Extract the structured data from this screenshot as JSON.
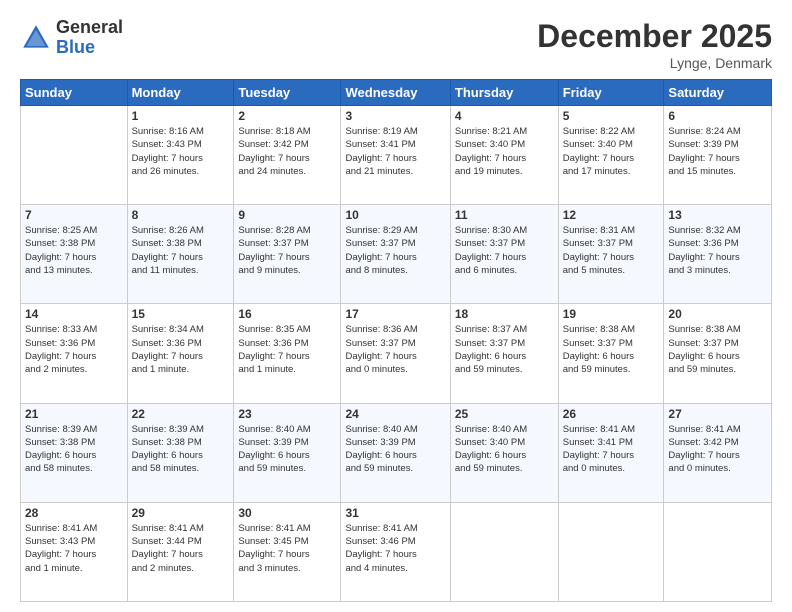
{
  "logo": {
    "general": "General",
    "blue": "Blue"
  },
  "title": "December 2025",
  "location": "Lynge, Denmark",
  "weekdays": [
    "Sunday",
    "Monday",
    "Tuesday",
    "Wednesday",
    "Thursday",
    "Friday",
    "Saturday"
  ],
  "weeks": [
    [
      {
        "num": "",
        "info": ""
      },
      {
        "num": "1",
        "info": "Sunrise: 8:16 AM\nSunset: 3:43 PM\nDaylight: 7 hours\nand 26 minutes."
      },
      {
        "num": "2",
        "info": "Sunrise: 8:18 AM\nSunset: 3:42 PM\nDaylight: 7 hours\nand 24 minutes."
      },
      {
        "num": "3",
        "info": "Sunrise: 8:19 AM\nSunset: 3:41 PM\nDaylight: 7 hours\nand 21 minutes."
      },
      {
        "num": "4",
        "info": "Sunrise: 8:21 AM\nSunset: 3:40 PM\nDaylight: 7 hours\nand 19 minutes."
      },
      {
        "num": "5",
        "info": "Sunrise: 8:22 AM\nSunset: 3:40 PM\nDaylight: 7 hours\nand 17 minutes."
      },
      {
        "num": "6",
        "info": "Sunrise: 8:24 AM\nSunset: 3:39 PM\nDaylight: 7 hours\nand 15 minutes."
      }
    ],
    [
      {
        "num": "7",
        "info": "Sunrise: 8:25 AM\nSunset: 3:38 PM\nDaylight: 7 hours\nand 13 minutes."
      },
      {
        "num": "8",
        "info": "Sunrise: 8:26 AM\nSunset: 3:38 PM\nDaylight: 7 hours\nand 11 minutes."
      },
      {
        "num": "9",
        "info": "Sunrise: 8:28 AM\nSunset: 3:37 PM\nDaylight: 7 hours\nand 9 minutes."
      },
      {
        "num": "10",
        "info": "Sunrise: 8:29 AM\nSunset: 3:37 PM\nDaylight: 7 hours\nand 8 minutes."
      },
      {
        "num": "11",
        "info": "Sunrise: 8:30 AM\nSunset: 3:37 PM\nDaylight: 7 hours\nand 6 minutes."
      },
      {
        "num": "12",
        "info": "Sunrise: 8:31 AM\nSunset: 3:37 PM\nDaylight: 7 hours\nand 5 minutes."
      },
      {
        "num": "13",
        "info": "Sunrise: 8:32 AM\nSunset: 3:36 PM\nDaylight: 7 hours\nand 3 minutes."
      }
    ],
    [
      {
        "num": "14",
        "info": "Sunrise: 8:33 AM\nSunset: 3:36 PM\nDaylight: 7 hours\nand 2 minutes."
      },
      {
        "num": "15",
        "info": "Sunrise: 8:34 AM\nSunset: 3:36 PM\nDaylight: 7 hours\nand 1 minute."
      },
      {
        "num": "16",
        "info": "Sunrise: 8:35 AM\nSunset: 3:36 PM\nDaylight: 7 hours\nand 1 minute."
      },
      {
        "num": "17",
        "info": "Sunrise: 8:36 AM\nSunset: 3:37 PM\nDaylight: 7 hours\nand 0 minutes."
      },
      {
        "num": "18",
        "info": "Sunrise: 8:37 AM\nSunset: 3:37 PM\nDaylight: 6 hours\nand 59 minutes."
      },
      {
        "num": "19",
        "info": "Sunrise: 8:38 AM\nSunset: 3:37 PM\nDaylight: 6 hours\nand 59 minutes."
      },
      {
        "num": "20",
        "info": "Sunrise: 8:38 AM\nSunset: 3:37 PM\nDaylight: 6 hours\nand 59 minutes."
      }
    ],
    [
      {
        "num": "21",
        "info": "Sunrise: 8:39 AM\nSunset: 3:38 PM\nDaylight: 6 hours\nand 58 minutes."
      },
      {
        "num": "22",
        "info": "Sunrise: 8:39 AM\nSunset: 3:38 PM\nDaylight: 6 hours\nand 58 minutes."
      },
      {
        "num": "23",
        "info": "Sunrise: 8:40 AM\nSunset: 3:39 PM\nDaylight: 6 hours\nand 59 minutes."
      },
      {
        "num": "24",
        "info": "Sunrise: 8:40 AM\nSunset: 3:39 PM\nDaylight: 6 hours\nand 59 minutes."
      },
      {
        "num": "25",
        "info": "Sunrise: 8:40 AM\nSunset: 3:40 PM\nDaylight: 6 hours\nand 59 minutes."
      },
      {
        "num": "26",
        "info": "Sunrise: 8:41 AM\nSunset: 3:41 PM\nDaylight: 7 hours\nand 0 minutes."
      },
      {
        "num": "27",
        "info": "Sunrise: 8:41 AM\nSunset: 3:42 PM\nDaylight: 7 hours\nand 0 minutes."
      }
    ],
    [
      {
        "num": "28",
        "info": "Sunrise: 8:41 AM\nSunset: 3:43 PM\nDaylight: 7 hours\nand 1 minute."
      },
      {
        "num": "29",
        "info": "Sunrise: 8:41 AM\nSunset: 3:44 PM\nDaylight: 7 hours\nand 2 minutes."
      },
      {
        "num": "30",
        "info": "Sunrise: 8:41 AM\nSunset: 3:45 PM\nDaylight: 7 hours\nand 3 minutes."
      },
      {
        "num": "31",
        "info": "Sunrise: 8:41 AM\nSunset: 3:46 PM\nDaylight: 7 hours\nand 4 minutes."
      },
      {
        "num": "",
        "info": ""
      },
      {
        "num": "",
        "info": ""
      },
      {
        "num": "",
        "info": ""
      }
    ]
  ]
}
